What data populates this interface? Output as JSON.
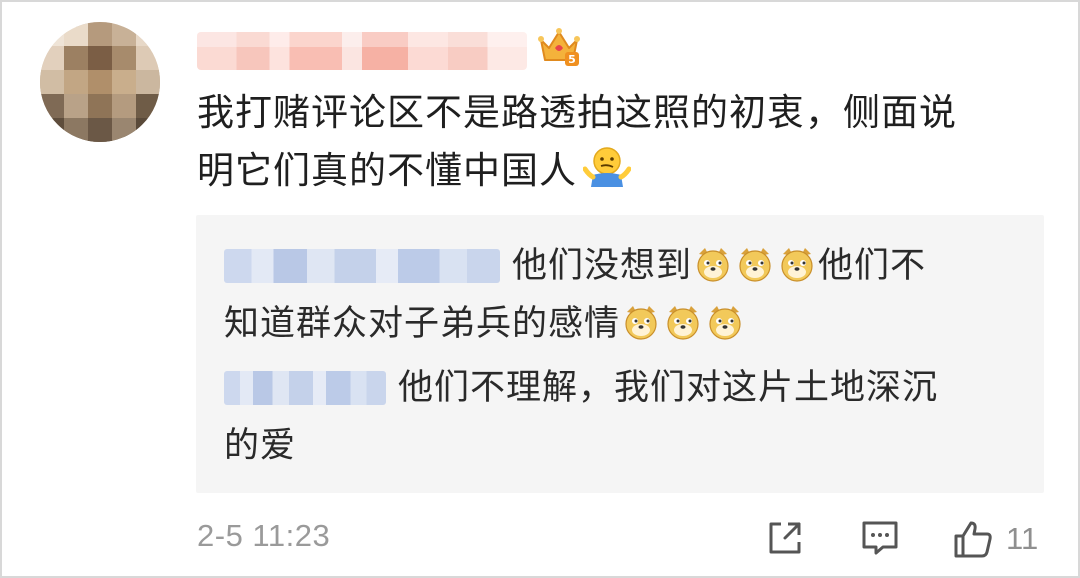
{
  "comment": {
    "crown_level": "5",
    "text_line1": "我打赌评论区不是路透拍这照的初衷，侧面说",
    "text_line2": "明它们真的不懂中国人",
    "emoji": "shrug-emoji"
  },
  "replies": [
    {
      "text_line1": "他们没想到",
      "text_line1b": "他们不",
      "text_line2": "知道群众对子弟兵的感情",
      "emojis": [
        "doge-emoji",
        "doge-emoji",
        "doge-emoji"
      ]
    },
    {
      "text_line1": "他们不理解，我们对这片土地深沉",
      "text_line2": "的爱"
    }
  ],
  "footer": {
    "timestamp": "2-5 11:23",
    "like_count": "11"
  },
  "icons": {
    "share": "share-icon",
    "comment": "comment-icon",
    "like": "thumbs-up-icon"
  },
  "colors": {
    "reply_background": "#f5f5f5",
    "meta_text": "#9a9a9a",
    "crown": "#f4b23b"
  }
}
